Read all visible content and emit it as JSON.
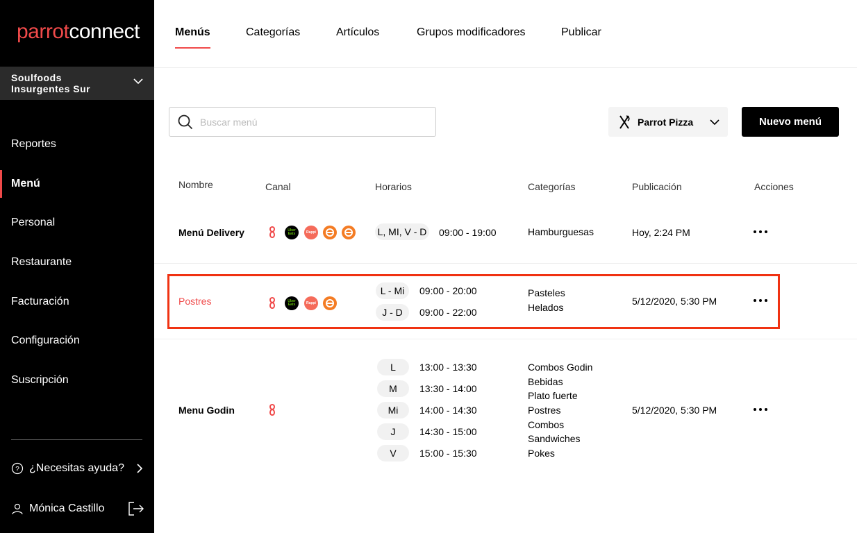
{
  "brand": {
    "logo_part1": "parrot",
    "logo_part2": "connect",
    "accent_color": "#f04a4a"
  },
  "store": {
    "name": "Soulfoods Insurgentes Sur"
  },
  "sidebar": {
    "items": [
      {
        "label": "Reportes"
      },
      {
        "label": "Menú"
      },
      {
        "label": "Personal"
      },
      {
        "label": "Restaurante"
      },
      {
        "label": "Facturación"
      },
      {
        "label": "Configuración"
      },
      {
        "label": "Suscripción"
      }
    ],
    "help_label": "¿Necesitas ayuda?",
    "user_name": "Mónica Castillo"
  },
  "tabs": [
    {
      "label": "Menús"
    },
    {
      "label": "Categorías"
    },
    {
      "label": "Artículos"
    },
    {
      "label": "Grupos modificadores"
    },
    {
      "label": "Publicar"
    }
  ],
  "search": {
    "placeholder": "Buscar menú"
  },
  "brand_select": {
    "value": "Parrot Pizza"
  },
  "new_menu_label": "Nuevo menú",
  "table": {
    "headers": {
      "name": "Nombre",
      "channel": "Canal",
      "schedule": "Horarios",
      "categories": "Categorías",
      "published": "Publicación",
      "actions": "Acciones"
    },
    "rows": [
      {
        "name": "Menú Delivery",
        "channels": [
          "parrot-icon",
          "uber-eats-icon",
          "rappi-icon",
          "didi-food-icon",
          "didi-food-icon"
        ],
        "schedules": [
          {
            "days": "L, MI, V - D",
            "hours": "09:00 - 19:00"
          }
        ],
        "categories": [
          "Hamburguesas"
        ],
        "published": "Hoy, 2:24 PM"
      },
      {
        "name": "Postres",
        "channels": [
          "parrot-icon",
          "uber-eats-icon",
          "rappi-icon",
          "didi-food-icon"
        ],
        "schedules": [
          {
            "days": "L - Mi",
            "hours": "09:00 - 20:00"
          },
          {
            "days": "J - D",
            "hours": "09:00 - 22:00"
          }
        ],
        "categories": [
          "Pasteles",
          "Helados"
        ],
        "published": "5/12/2020, 5:30 PM"
      },
      {
        "name": "Menu Godin",
        "channels": [
          "parrot-icon"
        ],
        "schedules": [
          {
            "days": "L",
            "hours": "13:00 - 13:30"
          },
          {
            "days": "M",
            "hours": "13:30 - 14:00"
          },
          {
            "days": "Mi",
            "hours": "14:00 - 14:30"
          },
          {
            "days": "J",
            "hours": "14:30 - 15:00"
          },
          {
            "days": "V",
            "hours": "15:00 - 15:30"
          }
        ],
        "categories": [
          "Combos Godin",
          "Bebidas",
          "Plato fuerte",
          "Postres",
          "Combos",
          "Sandwiches",
          "Pokes"
        ],
        "published": "5/12/2020, 5:30 PM"
      }
    ]
  },
  "channel_badges": {
    "uber_line1": "Uber",
    "uber_line2": "Eats",
    "rappi": "Rappi"
  }
}
